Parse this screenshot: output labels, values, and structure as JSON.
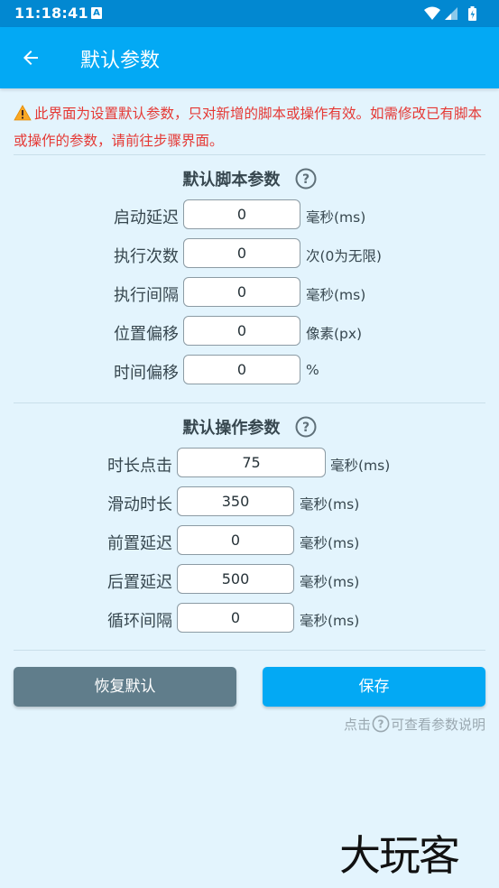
{
  "statusbar": {
    "time": "11:18:41",
    "notif": "A"
  },
  "appbar": {
    "title": "默认参数"
  },
  "notice": {
    "text": "此界面为设置默认参数，只对新增的脚本或操作有效。如需修改已有脚本或操作的参数，请前往步骤界面。"
  },
  "script_section": {
    "title": "默认脚本参数",
    "rows": [
      {
        "label": "启动延迟",
        "value": "0",
        "unit": "毫秒(ms)"
      },
      {
        "label": "执行次数",
        "value": "0",
        "unit": "次(0为无限)"
      },
      {
        "label": "执行间隔",
        "value": "0",
        "unit": "毫秒(ms)"
      },
      {
        "label": "位置偏移",
        "value": "0",
        "unit": "像素(px)"
      },
      {
        "label": "时间偏移",
        "value": "0",
        "unit": "%"
      }
    ]
  },
  "action_section": {
    "title": "默认操作参数",
    "rows": [
      {
        "label": "时长点击",
        "value": "75",
        "unit": "毫秒(ms)"
      },
      {
        "label": "滑动时长",
        "value": "350",
        "unit": "毫秒(ms)"
      },
      {
        "label": "前置延迟",
        "value": "0",
        "unit": "毫秒(ms)"
      },
      {
        "label": "后置延迟",
        "value": "500",
        "unit": "毫秒(ms)"
      },
      {
        "label": "循环间隔",
        "value": "0",
        "unit": "毫秒(ms)"
      }
    ]
  },
  "buttons": {
    "reset": "恢复默认",
    "save": "保存"
  },
  "hint": {
    "prefix": "点击",
    "suffix": "可查看参数说明"
  },
  "watermark": {
    "text": "大玩客"
  },
  "colors": {
    "appbar": "#03a9f4",
    "statusbar": "#0288d1",
    "warning": "#e53935",
    "reset_button": "#607d8b",
    "background": "#e3f4fd"
  }
}
